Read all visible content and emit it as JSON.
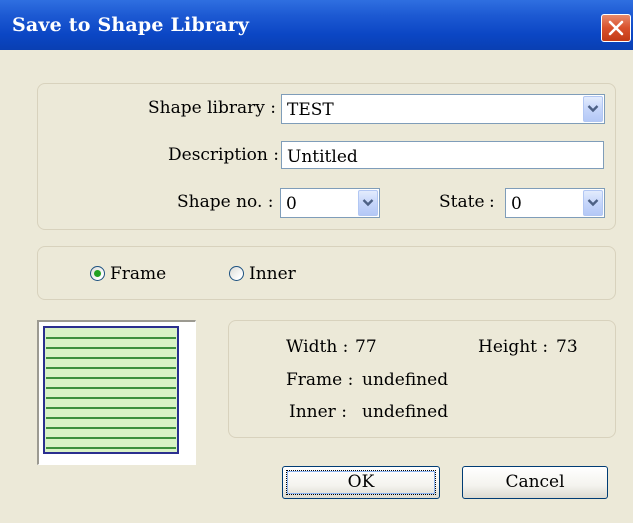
{
  "dialog": {
    "title": "Save to Shape Library"
  },
  "form": {
    "shape_library_label": "Shape library :",
    "shape_library_value": "TEST",
    "description_label": "Description :",
    "description_value": "Untitled",
    "shape_no_label": "Shape no. :",
    "shape_no_value": "0",
    "state_label": "State",
    "state_colon": ":",
    "state_value": "0"
  },
  "options": {
    "frame_label": "Frame",
    "inner_label": "Inner",
    "selected": "Frame"
  },
  "info": {
    "width_label": "Width :",
    "width_value": "77",
    "height_label": "Height :",
    "height_value": "73",
    "frame_label": "Frame :",
    "frame_value": "undefined",
    "inner_label": "Inner :",
    "inner_value": "undefined"
  },
  "buttons": {
    "ok_label": "OK",
    "cancel_label": "Cancel"
  },
  "colors": {
    "titlebar": "#0b46c4",
    "preview_border": "#2b2f8f",
    "preview_lines": "#3d8f3d",
    "preview_fill": "#d9f2c6",
    "radio_selected": "#21a121"
  }
}
